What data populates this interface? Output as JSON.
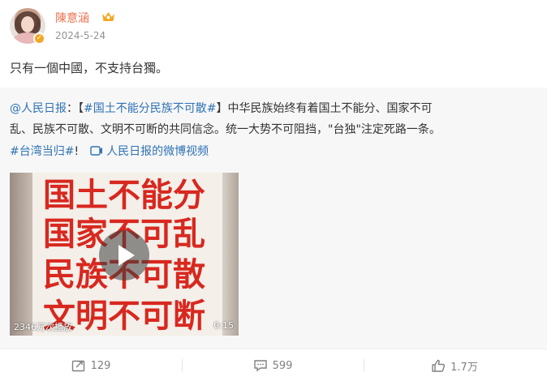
{
  "post": {
    "username": "陳意涵",
    "timestamp": "2024-5-24",
    "text": "只有一個中國，不支持台獨。",
    "verified_icon": "orange-verified-badge",
    "vip_icon": "crown-icon"
  },
  "repost": {
    "mention": "@人民日报",
    "colon": "：",
    "bracket_open": "【",
    "topic": "#国土不能分民族不可散#",
    "bracket_close": "】",
    "line1_text": "中华民族始终有着国土不能分、国家不可",
    "line2_text": "乱、民族不可散、文明不可断的共同信念。统一大势不可阻挡，\"台独\"注定死路一条。",
    "hashtag": "#台湾当归#",
    "exclaim": "!",
    "video_link": "人民日报的微博视频"
  },
  "video": {
    "lines": [
      "国土不能分",
      "国家不可乱",
      "民族不可散",
      "文明不可断"
    ],
    "views": "2346万次播放",
    "duration": "0:15"
  },
  "actions": {
    "repost_count": "129",
    "comment_count": "599",
    "like_count": "1.7万"
  },
  "colors": {
    "accent": "#eb7350",
    "link_blue": "#2f72b5",
    "video_red": "#d8281f"
  }
}
